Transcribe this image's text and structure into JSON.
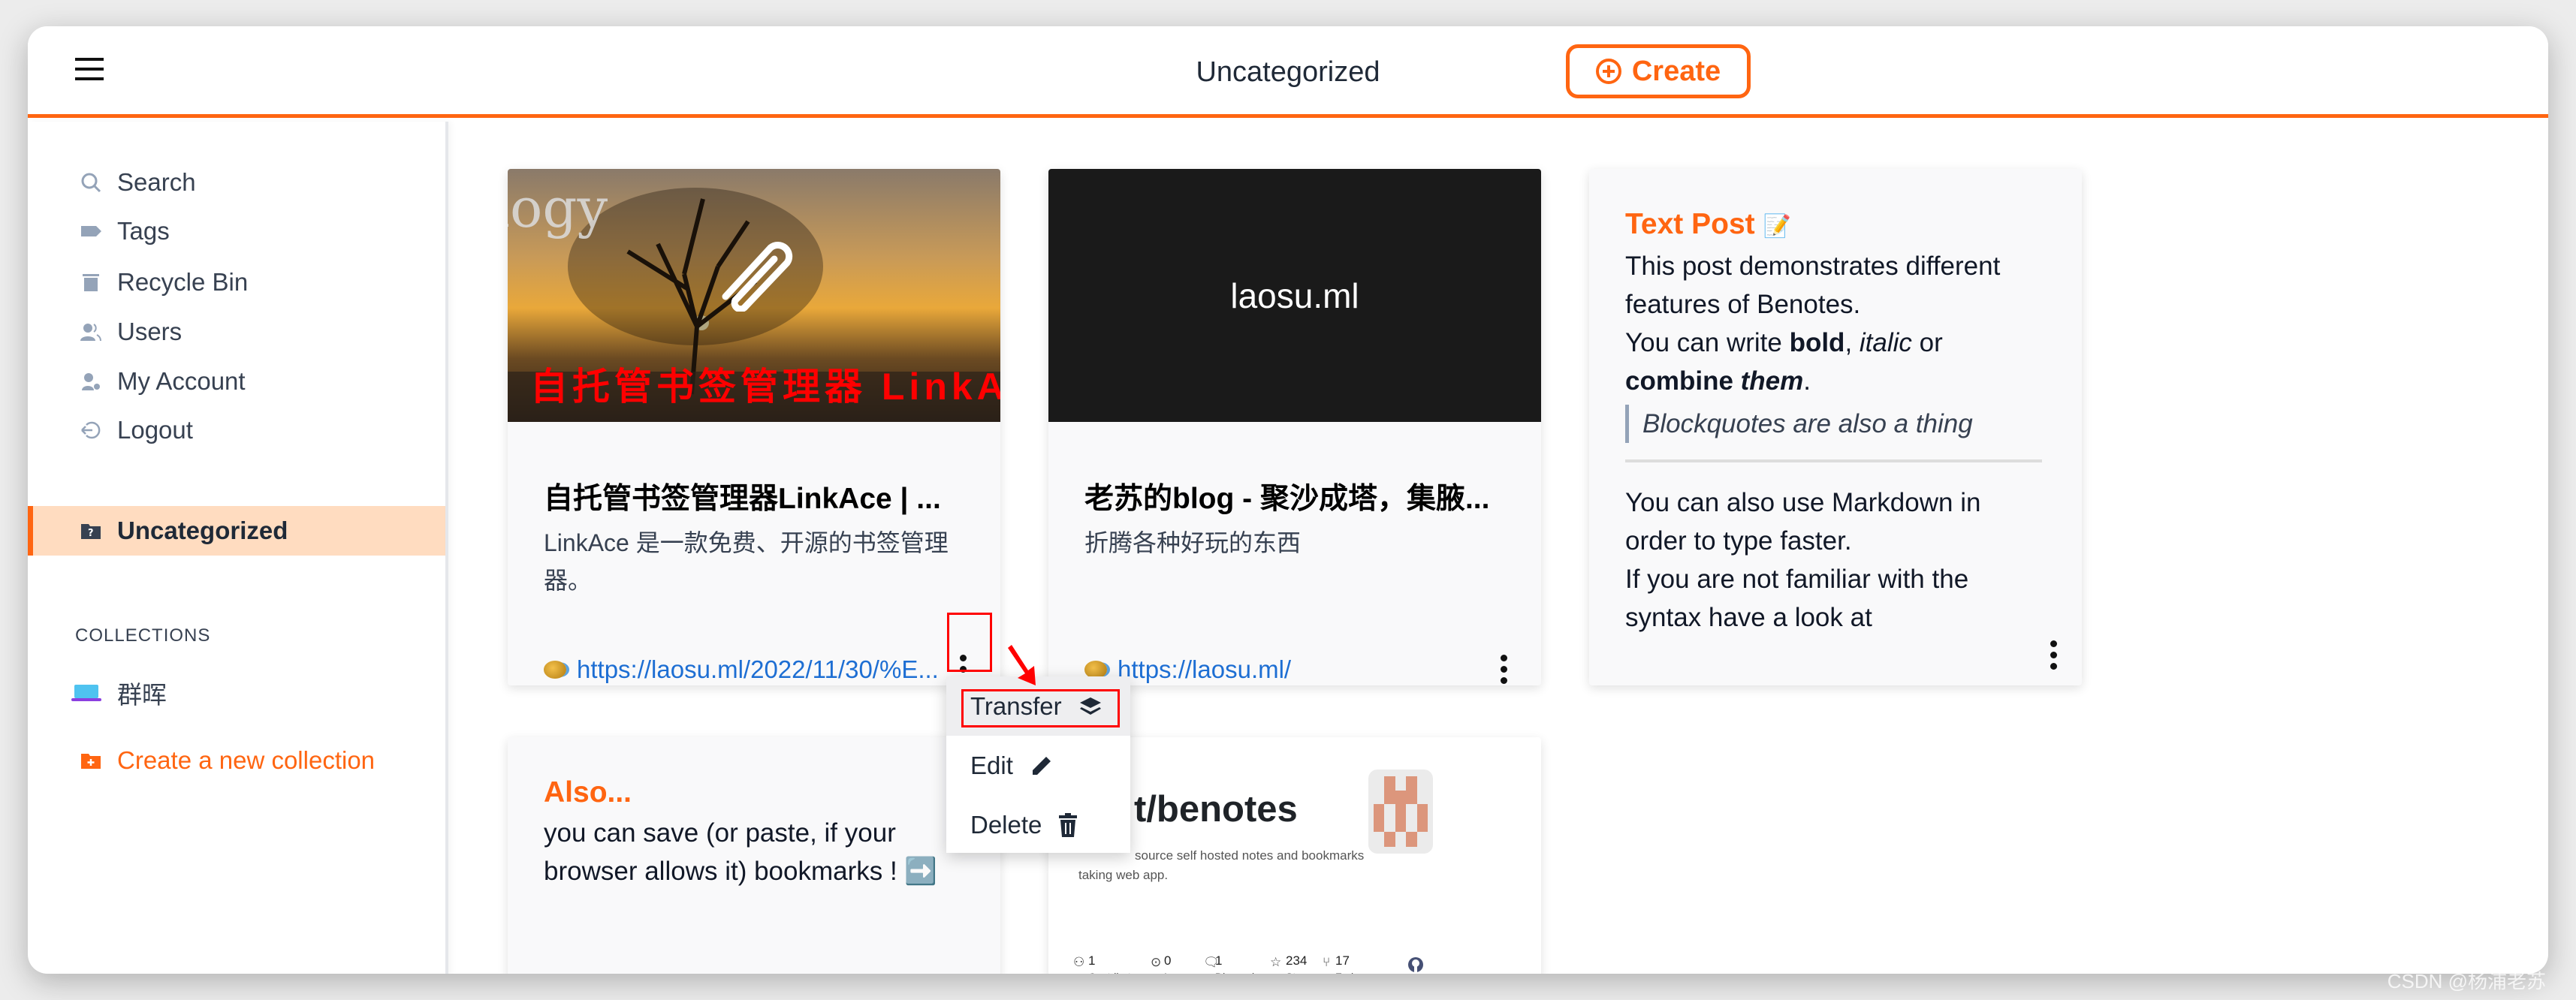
{
  "header": {
    "title": "Uncategorized",
    "create_label": "Create",
    "menu_icon": "hamburger-icon"
  },
  "sidebar": {
    "items": [
      {
        "label": "Search",
        "icon": "search-icon"
      },
      {
        "label": "Tags",
        "icon": "tag-icon"
      },
      {
        "label": "Recycle Bin",
        "icon": "trash-icon"
      },
      {
        "label": "Users",
        "icon": "users-icon"
      },
      {
        "label": "My Account",
        "icon": "user-cog-icon"
      },
      {
        "label": "Logout",
        "icon": "logout-icon"
      }
    ],
    "active": {
      "label": "Uncategorized",
      "icon": "folder-question-icon"
    },
    "collections_heading": "COLLECTIONS",
    "collections": [
      {
        "label": "群晖",
        "icon": "laptop-icon"
      }
    ],
    "create_collection": "Create a new collection"
  },
  "cards": [
    {
      "image_text": "自托管书签管理器 LinkAce",
      "image_watermark": "logy",
      "title": "自托管书签管理器LinkAce | ...",
      "description": "LinkAce 是一款免费、开源的书签管理器。",
      "link": "https://laosu.ml/2022/11/30/%E..."
    },
    {
      "image_text": "laosu.ml",
      "title": "老苏的blog - 聚沙成塔，集腋...",
      "description": "折腾各种好玩的东西",
      "link": "https://laosu.ml/"
    },
    {
      "title": "Text Post",
      "lines": [
        "This post demonstrates different features of Benotes.",
        "You can write ",
        "bold",
        ", ",
        "italic",
        " or",
        "combine ",
        "them",
        "."
      ],
      "blockquote": "Blockquotes are also a thing",
      "para2": "You can also use Markdown in order to type faster.",
      "para3": "If you are not familiar with the syntax have a look at"
    },
    {
      "title": "Also...",
      "text": "you can save (or paste, if your browser allows it) bookmarks ! ➡️"
    },
    {
      "repo": "t/benotes",
      "desc1": "source self hosted notes and bookmarks",
      "desc2": "taking web app.",
      "stats": [
        {
          "value": "1",
          "label": "Contributor"
        },
        {
          "value": "0",
          "label": "Issues"
        },
        {
          "value": "1",
          "label": "Discussion"
        },
        {
          "value": "234",
          "label": "Stars"
        },
        {
          "value": "17",
          "label": "Forks"
        }
      ]
    }
  ],
  "context_menu": {
    "items": [
      {
        "label": "Transfer",
        "icon": "layers-icon"
      },
      {
        "label": "Edit",
        "icon": "pencil-icon"
      },
      {
        "label": "Delete",
        "icon": "trash-icon"
      }
    ]
  },
  "watermark": "CSDN @杨浦老苏",
  "colors": {
    "accent": "#ff6511",
    "active_bg": "#ffdcc0",
    "link": "#1d6ed3"
  }
}
